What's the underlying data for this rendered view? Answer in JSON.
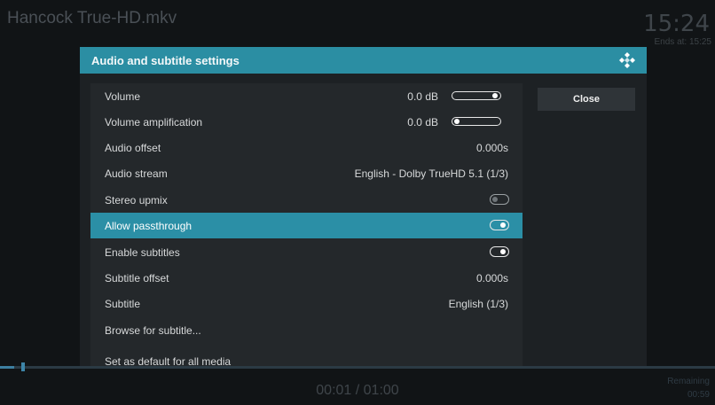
{
  "player": {
    "title": "Hancock True-HD.mkv",
    "clock": "15:24",
    "ends_at": "Ends at: 15:25",
    "time": "00:01 / 01:00",
    "remaining_label": "Remaining",
    "remaining_value": "00:59",
    "progress_percent": 2
  },
  "dialog": {
    "title": "Audio and subtitle settings",
    "close_label": "Close",
    "accent_color": "#2b8ea3",
    "rows": [
      {
        "label": "Volume",
        "value": "0.0 dB",
        "control": "slider",
        "level": 1.0
      },
      {
        "label": "Volume amplification",
        "value": "0.0 dB",
        "control": "slider",
        "level": 0.0
      },
      {
        "label": "Audio offset",
        "value": "0.000s"
      },
      {
        "label": "Audio stream",
        "value": "English - Dolby TrueHD 5.1 (1/3)"
      },
      {
        "label": "Stereo upmix",
        "control": "toggle",
        "on": false
      },
      {
        "label": "Allow passthrough",
        "control": "toggle",
        "on": true,
        "selected": true
      },
      {
        "label": "Enable subtitles",
        "control": "toggle",
        "on": true
      },
      {
        "label": "Subtitle offset",
        "value": "0.000s"
      },
      {
        "label": "Subtitle",
        "value": "English (1/3)"
      },
      {
        "label": "Browse for subtitle..."
      },
      {
        "label": "Set as default for all media"
      }
    ]
  }
}
